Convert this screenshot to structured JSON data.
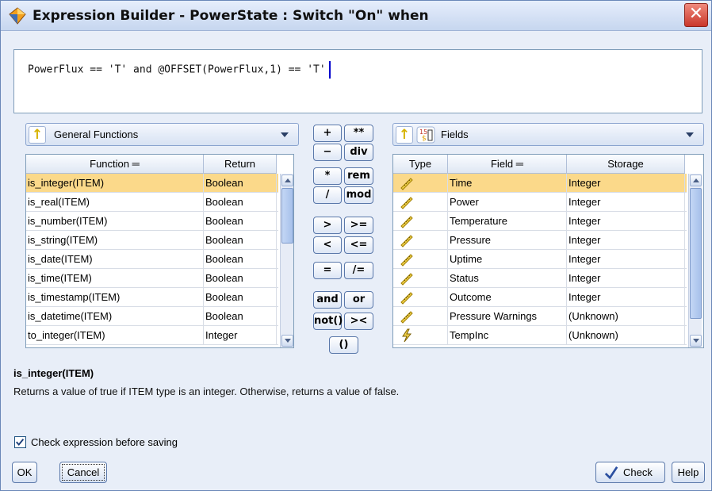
{
  "window": {
    "title": "Expression Builder - PowerState : Switch \"On\" when",
    "close_label": "✕"
  },
  "expression": {
    "text": "PowerFlux == 'T' and @OFFSET(PowerFlux,1) == 'T'"
  },
  "functions_panel": {
    "dropdown_value": "General Functions",
    "up_icon": "↑",
    "columns": {
      "function": "Function",
      "return": "Return"
    },
    "rows": [
      {
        "function": "is_integer(ITEM)",
        "return": "Boolean",
        "selected": true
      },
      {
        "function": "is_real(ITEM)",
        "return": "Boolean"
      },
      {
        "function": "is_number(ITEM)",
        "return": "Boolean"
      },
      {
        "function": "is_string(ITEM)",
        "return": "Boolean"
      },
      {
        "function": "is_date(ITEM)",
        "return": "Boolean"
      },
      {
        "function": "is_time(ITEM)",
        "return": "Boolean"
      },
      {
        "function": "is_timestamp(ITEM)",
        "return": "Boolean"
      },
      {
        "function": "is_datetime(ITEM)",
        "return": "Boolean"
      },
      {
        "function": "to_integer(ITEM)",
        "return": "Integer"
      }
    ]
  },
  "operators": {
    "plus": "+",
    "power": "**",
    "minus": "−",
    "div": "div",
    "times": "*",
    "rem": "rem",
    "divide": "/",
    "mod": "mod",
    "gt": ">",
    "gte": ">=",
    "lt": "<",
    "lte": "<=",
    "eq": "=",
    "neq": "/=",
    "and": "and",
    "or": "or",
    "not": "not()",
    "concat": "><",
    "parens": "()"
  },
  "fields_panel": {
    "dropdown_value": "Fields",
    "up_icon": "↑",
    "columns": {
      "type": "Type",
      "field": "Field",
      "storage": "Storage"
    },
    "rows": [
      {
        "type_icon": "ruler-icon",
        "field": "Time",
        "storage": "Integer",
        "selected": true
      },
      {
        "type_icon": "ruler-icon",
        "field": "Power",
        "storage": "Integer"
      },
      {
        "type_icon": "ruler-icon",
        "field": "Temperature",
        "storage": "Integer"
      },
      {
        "type_icon": "ruler-icon",
        "field": "Pressure",
        "storage": "Integer"
      },
      {
        "type_icon": "ruler-icon",
        "field": "Uptime",
        "storage": "Integer"
      },
      {
        "type_icon": "ruler-icon",
        "field": "Status",
        "storage": "Integer"
      },
      {
        "type_icon": "ruler-icon",
        "field": "Outcome",
        "storage": "Integer"
      },
      {
        "type_icon": "ruler-icon",
        "field": "Pressure Warnings",
        "storage": "(Unknown)"
      },
      {
        "type_icon": "lightning-icon",
        "field": "TempInc",
        "storage": "(Unknown)"
      }
    ]
  },
  "description": {
    "title": "is_integer(ITEM)",
    "text": "Returns a value of true if ITEM type is an integer. Otherwise, returns a value of false."
  },
  "check_before_saving": {
    "label": "Check expression before saving",
    "checked": true
  },
  "buttons": {
    "ok": "OK",
    "cancel": "Cancel",
    "check": "Check",
    "help": "Help"
  },
  "colors": {
    "selection": "#fbd98a",
    "accent": "#5a78aa"
  }
}
